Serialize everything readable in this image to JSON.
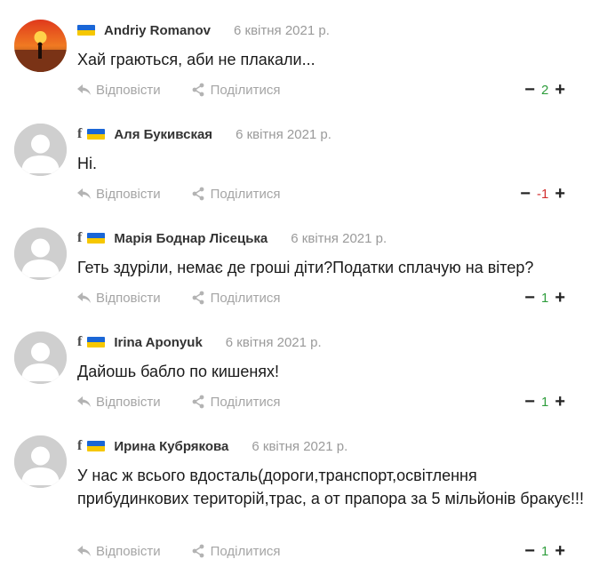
{
  "icons": {
    "facebook": "f",
    "reply": "reply-arrow-icon",
    "share": "share-icon",
    "flag": "ukraine-flag-icon"
  },
  "colors": {
    "positive": "#2e9d3c",
    "negative": "#d22e2e",
    "flag_blue": "#1a66d6",
    "flag_yellow": "#f6c700"
  },
  "comments": [
    {
      "author": "Andriy Romanov",
      "date": "6 квітня 2021 р.",
      "text": "Хай граються, аби не плакали...",
      "reply": "Відповісти",
      "share": "Поділитися",
      "minus": "−",
      "plus": "+",
      "score": "2",
      "score_sign": "positive",
      "facebook": false,
      "avatar": "sunset-photo"
    },
    {
      "author": "Аля Букивская",
      "date": "6 квітня 2021 р.",
      "text": "Ні.",
      "reply": "Відповісти",
      "share": "Поділитися",
      "minus": "−",
      "plus": "+",
      "score": "-1",
      "score_sign": "negative",
      "facebook": true,
      "avatar": "default"
    },
    {
      "author": "Марія Боднар Лісецька",
      "date": "6 квітня 2021 р.",
      "text": "Геть здуріли, немає де гроші діти?Податки сплачую на вітер?",
      "reply": "Відповісти",
      "share": "Поділитися",
      "minus": "−",
      "plus": "+",
      "score": "1",
      "score_sign": "positive",
      "facebook": true,
      "avatar": "default"
    },
    {
      "author": "Irina Aponyuk",
      "date": "6 квітня 2021 р.",
      "text": "Дайошь бабло по кишенях!",
      "reply": "Відповісти",
      "share": "Поділитися",
      "minus": "−",
      "plus": "+",
      "score": "1",
      "score_sign": "positive",
      "facebook": true,
      "avatar": "default"
    },
    {
      "author": "Ирина Кубрякова",
      "date": "6 квітня 2021 р.",
      "text": "У нас ж всього вдосталь(дороги,транспорт,освітлення прибудинкових територій,трас, а от прапора за 5 мільйонів бракує!!!",
      "reply": "Відповісти",
      "share": "Поділитися",
      "minus": "−",
      "plus": "+",
      "score": "1",
      "score_sign": "positive",
      "facebook": true,
      "avatar": "default"
    }
  ]
}
